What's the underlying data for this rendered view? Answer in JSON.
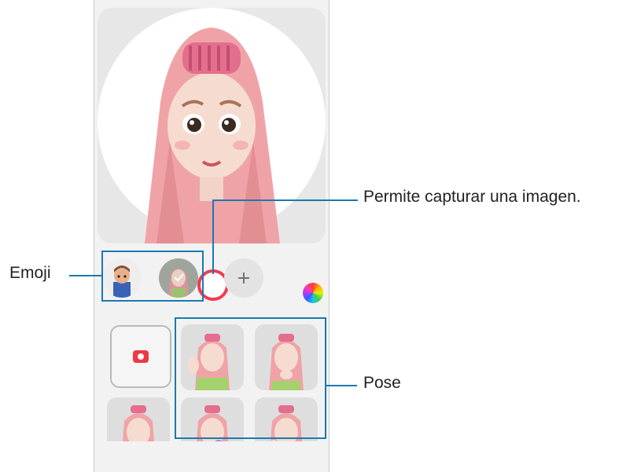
{
  "callouts": {
    "capture": "Permite capturar una imagen.",
    "emoji": "Emoji",
    "pose": "Pose"
  },
  "emoji_bar": {
    "add_symbol": "+"
  },
  "icons": {
    "shutter": "shutter-button",
    "color": "color-wheel-icon",
    "camera": "camera-icon"
  },
  "colors": {
    "accent": "#1b79b1",
    "shutter_ring": "#ef3b52",
    "camera_icon": "#ee3845"
  }
}
